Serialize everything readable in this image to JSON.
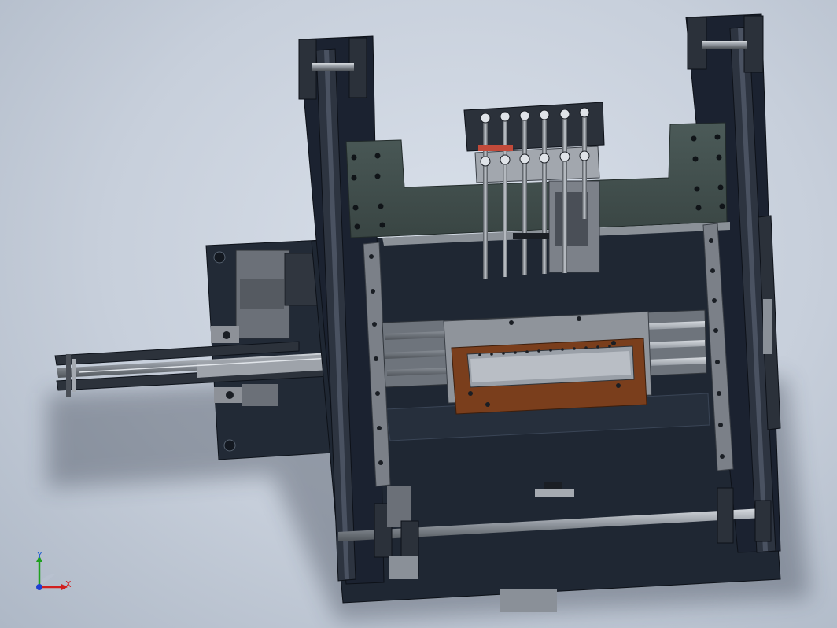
{
  "scene": {
    "background_color": "#c9d1dc",
    "frame_color": "#1c2330",
    "plate_color": "#3d4a4a",
    "rail_color": "#5b5f66",
    "fixture_color": "#7a3e1c"
  },
  "triad": {
    "x_label": "X",
    "y_label": "Y",
    "x_color": "#d11f1f",
    "y_color": "#1fa11f",
    "z_color": "#1f3fd1",
    "icon": "coordinate-triad-icon"
  }
}
